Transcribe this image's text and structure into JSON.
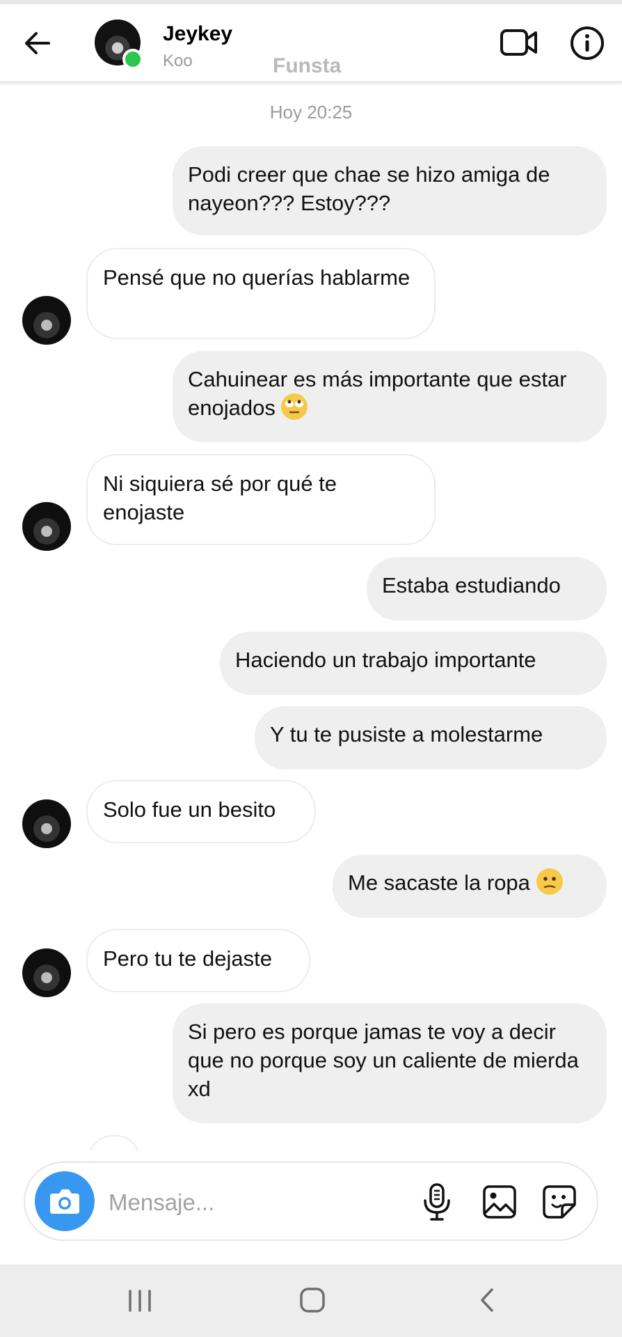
{
  "header": {
    "contact_name": "Jeykey",
    "contact_username": "Koo",
    "account_label": "Funsta",
    "icons": [
      "back-arrow-icon",
      "video-call-icon",
      "info-icon"
    ]
  },
  "conversation": {
    "timestamp": "Hoy 20:25",
    "messages": [
      {
        "side": "sent",
        "text": "Podi creer que chae se hizo amiga de nayeon??? Estoy???"
      },
      {
        "side": "received",
        "text": "Pensé que no querías hablarme"
      },
      {
        "side": "sent",
        "text": "Cahuinear es más importante que estar enojados",
        "emoji": "face-with-rolling-eyes"
      },
      {
        "side": "received",
        "text": "Ni siquiera sé por qué te enojaste"
      },
      {
        "side": "sent",
        "text": "Estaba estudiando"
      },
      {
        "side": "sent",
        "text": "Haciendo un trabajo importante"
      },
      {
        "side": "sent",
        "text": "Y tu te pusiste a molestarme"
      },
      {
        "side": "received",
        "text": "Solo fue un besito"
      },
      {
        "side": "sent",
        "text": "Me sacaste la ropa",
        "emoji": "confused-face"
      },
      {
        "side": "received",
        "text": "Pero tu te dejaste"
      },
      {
        "side": "sent",
        "text": "Si pero es porque jamas te voy a decir que no porque soy un caliente de mierda xd"
      }
    ]
  },
  "composer": {
    "placeholder": "Mensaje...",
    "icons": [
      "camera-icon",
      "microphone-icon",
      "gallery-icon",
      "sticker-icon"
    ],
    "camera_color": "#3897f0"
  },
  "system_nav": {
    "icons": [
      "recent-apps-icon",
      "home-icon",
      "back-icon"
    ]
  },
  "colors": {
    "sent_bubble": "#efefef",
    "received_bubble_border": "#ececec",
    "online_indicator": "#2cc64a",
    "secondary_text": "#9b9b9b"
  }
}
